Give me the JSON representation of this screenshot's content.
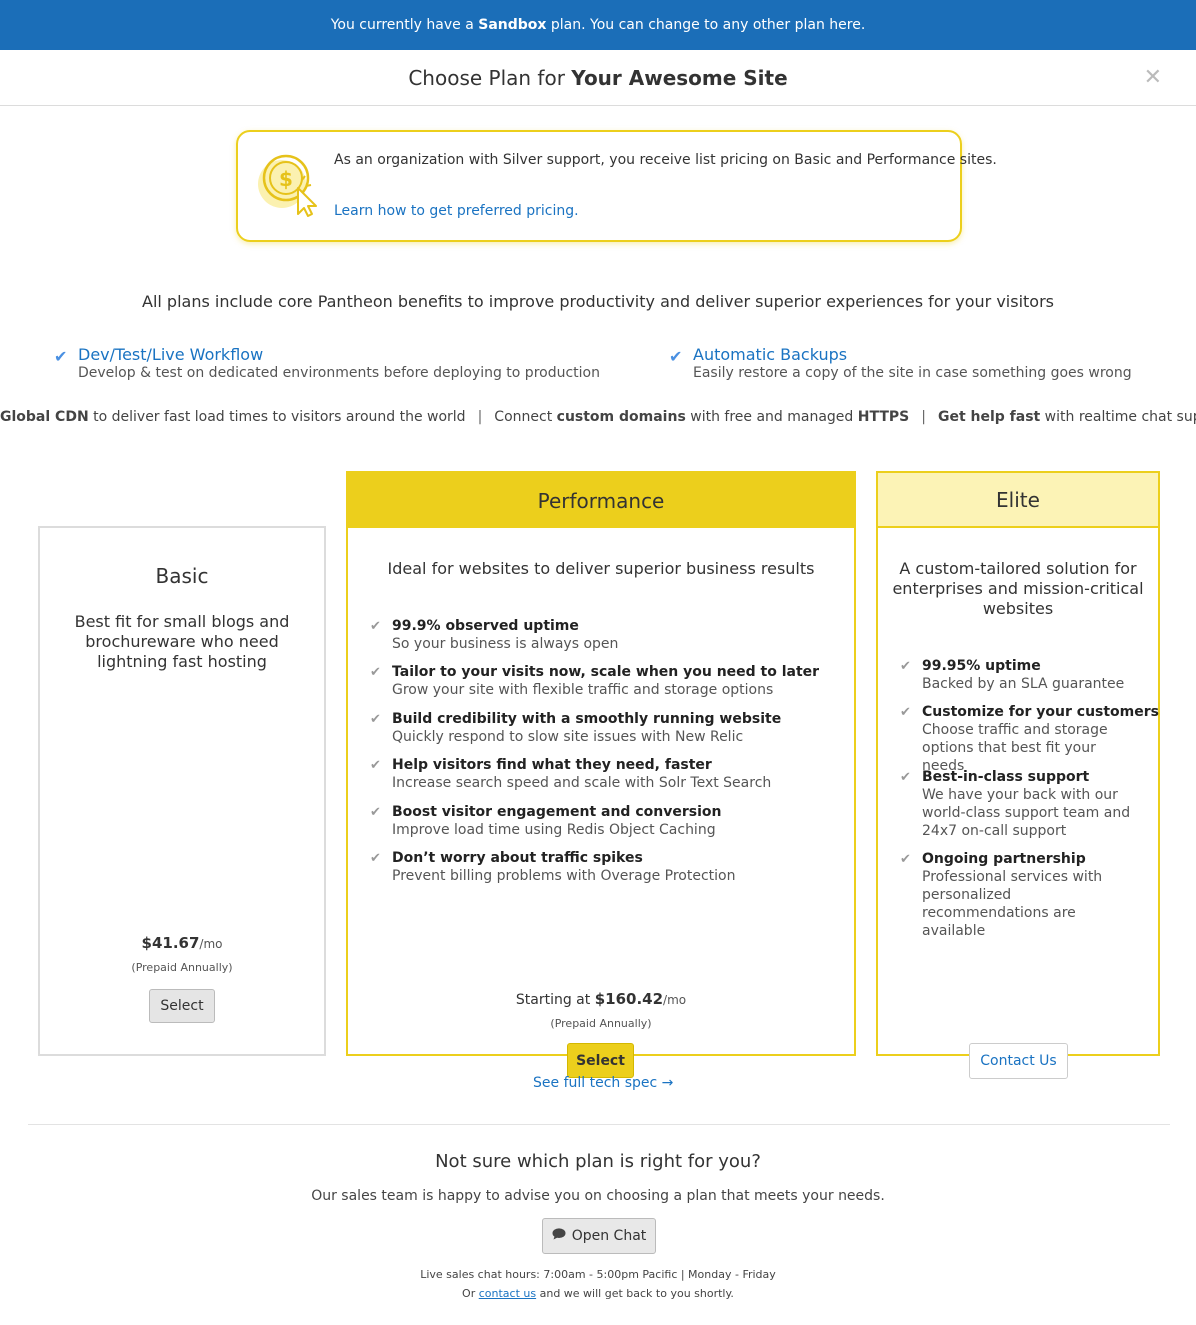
{
  "banner": {
    "prefix": "You currently have a ",
    "plan": "Sandbox",
    "suffix": " plan. You can change to any other plan here."
  },
  "header": {
    "prefix": "Choose Plan for ",
    "site_name": "Your Awesome Site",
    "close_glyph": "✕"
  },
  "notice": {
    "text": "As an organization with Silver support, you receive list pricing on Basic and Performance sites.",
    "link": "Learn how to get preferred pricing."
  },
  "core": {
    "title": "All plans include core Pantheon benefits to improve productivity and deliver superior experiences for your visitors",
    "benefits": [
      {
        "title": "Dev/Test/Live Workflow",
        "desc": "Develop & test on dedicated environments before deploying to production"
      },
      {
        "title": "Automatic Backups",
        "desc": "Easily restore a copy of the site in case something goes wrong"
      }
    ],
    "line": {
      "a_bold": "Global CDN",
      "a_rest": " to deliver fast load times to visitors around the world",
      "b_pre": "Connect ",
      "b_bold": "custom domains",
      "b_mid": " with free and managed ",
      "b_bold2": "HTTPS",
      "c_bold": "Get help fast",
      "c_rest": " with realtime chat support",
      "separator": "|"
    }
  },
  "plans": {
    "basic": {
      "name": "Basic",
      "desc": "Best fit for small blogs and brochureware who need lightning fast hosting",
      "price": "$41.67",
      "per": "/mo",
      "prepaid": "(Prepaid Annually)",
      "button": "Select"
    },
    "performance": {
      "name": "Performance",
      "desc": "Ideal for websites to deliver superior business results",
      "features": [
        {
          "title": "99.9% observed uptime",
          "desc": "So your business is always open"
        },
        {
          "title": "Tailor to your visits now, scale when you need to later",
          "desc": "Grow your site with flexible traffic and storage options"
        },
        {
          "title": "Build credibility with a smoothly running website",
          "desc": "Quickly respond to slow site issues with New Relic"
        },
        {
          "title": "Help visitors find what they need, faster",
          "desc": "Increase search speed and scale with Solr Text Search"
        },
        {
          "title": "Boost visitor engagement and conversion",
          "desc": "Improve load time using Redis Object Caching"
        },
        {
          "title": "Don’t worry about traffic spikes",
          "desc": "Prevent billing problems with Overage Protection"
        }
      ],
      "price_prefix": "Starting at ",
      "price": "$160.42",
      "per": "/mo",
      "prepaid": "(Prepaid Annually)",
      "button": "Select",
      "tech_link": "See full tech spec →"
    },
    "elite": {
      "name": "Elite",
      "desc": "A custom-tailored solution for enterprises and mission-critical websites",
      "features": [
        {
          "title": "99.95% uptime",
          "desc": "Backed by an SLA guarantee"
        },
        {
          "title": "Customize for your customers",
          "desc": "Choose traffic and storage options that best fit your needs"
        },
        {
          "title": "Best-in-class support",
          "desc": "We have your back with our world-class support team and 24x7 on-call support"
        },
        {
          "title": "Ongoing partnership",
          "desc": "Professional services with personalized recommendations are available"
        }
      ],
      "button": "Contact Us"
    }
  },
  "help": {
    "title": "Not sure which plan is right for you?",
    "desc": "Our sales team is happy to advise you on choosing a plan that meets your needs.",
    "chat_button": "Open Chat",
    "hours": "Live sales chat hours: 7:00am - 5:00pm Pacific | Monday - Friday",
    "contact_pre": "Or ",
    "contact_link": "contact us",
    "contact_post": " and we will get back to you shortly."
  },
  "colors": {
    "banner": "#1b6eb8",
    "accent_yellow": "#eccf1c",
    "elite_header": "#fcf3b6",
    "link_blue": "#1a73c2"
  },
  "icons": {
    "check": "✔",
    "chat": "💬"
  }
}
